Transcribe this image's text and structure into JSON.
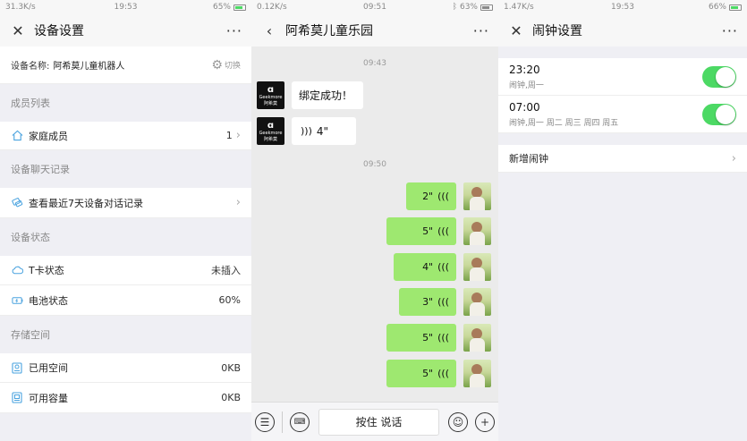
{
  "screen1": {
    "status": {
      "left": "31.3K/s",
      "time": "19:53",
      "battery": "65%"
    },
    "nav": {
      "title": "设备设置",
      "more": "···"
    },
    "device": {
      "label": "设备名称:",
      "name": "阿希莫儿童机器人",
      "switch_label": "切换"
    },
    "sections": {
      "members": "成员列表",
      "chat": "设备聊天记录",
      "status": "设备状态",
      "storage": "存储空间"
    },
    "family": {
      "label": "家庭成员",
      "count": "1"
    },
    "chat_records": {
      "label": "查看最近7天设备对话记录"
    },
    "tcard": {
      "label": "T卡状态",
      "value": "未插入"
    },
    "battery": {
      "label": "电池状态",
      "value": "60%"
    },
    "used": {
      "label": "已用空间",
      "value": "0KB"
    },
    "available": {
      "label": "可用容量",
      "value": "0KB"
    }
  },
  "screen2": {
    "status": {
      "left": "0.12K/s",
      "time": "09:51",
      "battery": "63%"
    },
    "nav": {
      "title": "阿希莫儿童乐园",
      "more": "···"
    },
    "times": [
      "09:43",
      "09:50"
    ],
    "bot_avatar": {
      "brand": "Geekmore",
      "name": "阿希莫"
    },
    "incoming": [
      {
        "text": "绑定成功！"
      },
      {
        "text": "4\""
      }
    ],
    "outgoing": [
      {
        "text": "2\""
      },
      {
        "text": "5\""
      },
      {
        "text": "4\""
      },
      {
        "text": "3\""
      },
      {
        "text": "5\""
      },
      {
        "text": "5\""
      }
    ],
    "talk_label": "按住 说话"
  },
  "screen3": {
    "status": {
      "left": "1.47K/s",
      "time": "19:53",
      "battery": "66%"
    },
    "nav": {
      "title": "闹钟设置",
      "more": "···"
    },
    "alarms": [
      {
        "time": "23:20",
        "repeat": "闹钟,周一",
        "on": true
      },
      {
        "time": "07:00",
        "repeat": "闹钟,周一 周二 周三 周四 周五",
        "on": true
      }
    ],
    "add_label": "新增闹钟"
  },
  "colors": {
    "accent_green": "#4cd964",
    "bubble_green": "#9ee870"
  }
}
